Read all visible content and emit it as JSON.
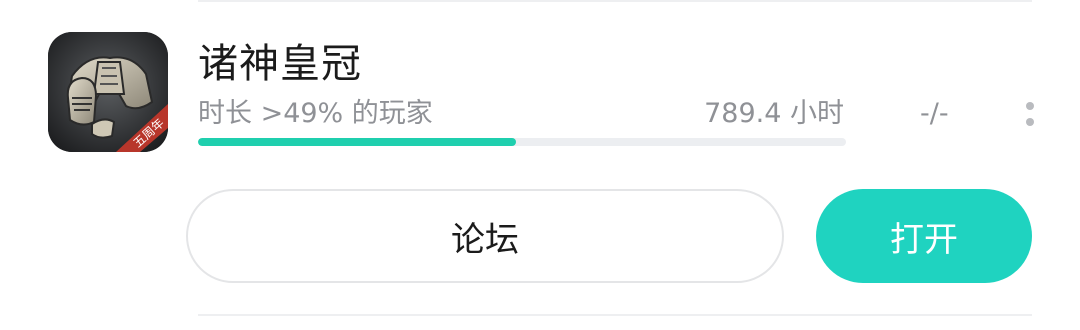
{
  "game": {
    "title": "诸神皇冠",
    "icon": "armored-knight-game-icon",
    "icon_badge": "五周年",
    "stat_label": "时长 >49% 的玩家",
    "playtime": "789.4 小时",
    "rating": "-/-",
    "playtime_percentile": 0.49
  },
  "actions": {
    "forum_label": "论坛",
    "open_label": "打开"
  },
  "colors": {
    "accent": "#1fd3c0",
    "progress": "#1fcfae",
    "muted_text": "#8f9196",
    "track": "#eceef1"
  },
  "icons": {
    "more": "more-vertical-icon"
  }
}
